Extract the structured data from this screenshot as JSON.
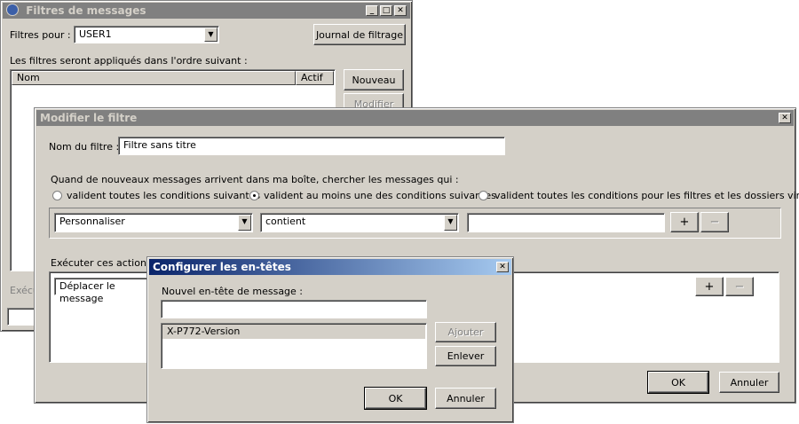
{
  "filters_window": {
    "title": "Filtres de messages",
    "filters_for_label": "Filtres pour :",
    "account_value": "USER1",
    "journal_button": "Journal de filtrage",
    "order_text": "Les filtres seront appliqués dans l'ordre suivant :",
    "col_name": "Nom",
    "col_active": "Actif",
    "new_button": "Nouveau",
    "edit_button": "Modifier",
    "partial_label": "Exécu"
  },
  "edit_filter": {
    "title": "Modifier le filtre",
    "name_label": "Nom du filtre :",
    "name_value": "Filtre sans titre",
    "when_text": "Quand de nouveaux messages arrivent dans ma boîte, chercher les messages qui :",
    "radio_all": "valident toutes les conditions suivantes",
    "radio_any": "valident au moins une des conditions suivantes",
    "radio_all_virtual": "valident toutes les conditions pour les filtres et les dossiers virtuels",
    "field_select": "Personnaliser",
    "operator_select": "contient",
    "value_input": "",
    "plus": "+",
    "minus": "−",
    "actions_label": "Exécuter ces actions :",
    "action_select": "Déplacer le message",
    "ok_button": "OK",
    "cancel_button": "Annuler"
  },
  "headers_dialog": {
    "title": "Configurer les en-têtes",
    "new_header_label": "Nouvel en-tête de message :",
    "new_header_value": "",
    "list_items": [
      "X-P772-Version"
    ],
    "add_button": "Ajouter",
    "remove_button": "Enlever",
    "ok_button": "OK",
    "cancel_button": "Annuler"
  }
}
